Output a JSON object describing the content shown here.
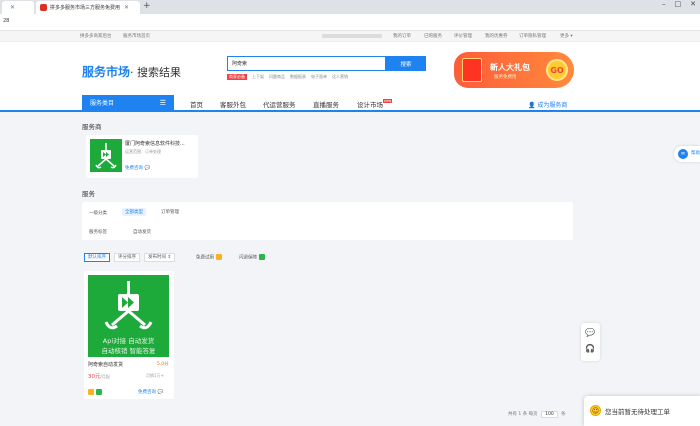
{
  "browser": {
    "tab1_label": "",
    "tab2_label": "拼多多服务市场三方服务免费用",
    "url_text": "28"
  },
  "topnav": {
    "left": [
      "拼多多商家后台",
      "服务市场首页"
    ],
    "right": [
      "我的订单",
      "已购服务",
      "评价管理",
      "我的优惠券",
      "订单隐私管理",
      "更多 ▾"
    ]
  },
  "header": {
    "logo": "服务市场",
    "logo_sub": "· 搜索结果",
    "search_value": "阿奇索",
    "search_button": "搜索",
    "hot_label": "商家必备",
    "hot_words": [
      "上下架",
      "问题商品",
      "数据报表",
      "电子面单",
      "达人营销"
    ],
    "promo_title": "新人大礼包",
    "promo_sub": "服务免费用",
    "promo_coin": "GO"
  },
  "catnav": {
    "all_label": "服务类目",
    "links": [
      "首页",
      "客服外包",
      "代运营服务",
      "直播服务",
      "设计市场"
    ],
    "design_badge": "new",
    "become_provider": "成为服务商"
  },
  "providers": {
    "section_title": "服务商",
    "name": "厦门阿奇索信息软件科技...",
    "sub": "运营范围：订单处理",
    "consult": "免费咨询"
  },
  "services": {
    "section_title": "服务",
    "row1_label": "一级分类",
    "row1_chips": [
      "全部类型",
      "订单管理"
    ],
    "row2_label": "服务标签",
    "row2_chips": [
      "自动发货"
    ]
  },
  "sortbar": {
    "default": "默认排序",
    "rating": "评分排序",
    "time": "发布时间 ⇕",
    "free_trial": "免费试用",
    "compensate": "闪退保障"
  },
  "product": {
    "img_lines": [
      "Api对接  自动发货",
      "自动核销  智能答复"
    ],
    "name": "阿奇索自动发货",
    "score": "5.0分",
    "price": "30元",
    "price_unit": "/月起",
    "sold": "月销1万+",
    "consult": "免费咨询"
  },
  "side_float_label": "帮助",
  "pager": {
    "total": "共有 1 条",
    "per_page": "每页",
    "per_page_value": "100",
    "per_page_unit": "条"
  },
  "ticket_popup": "您当前暂无待处理工单",
  "colors": {
    "primary": "#1e82f0",
    "green": "#1ea93b",
    "red": "#e44444"
  }
}
